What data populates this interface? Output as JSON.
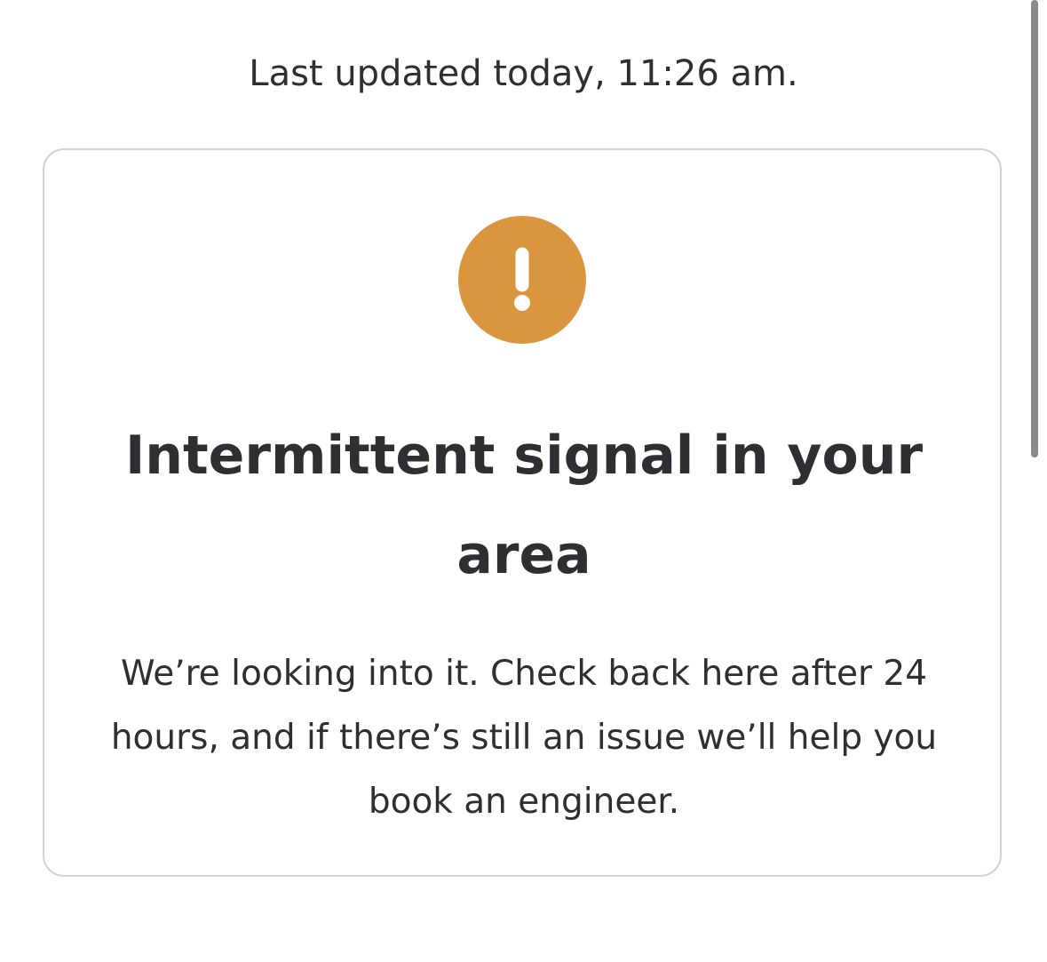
{
  "status": {
    "last_updated": "Last updated today, 11:26 am."
  },
  "alert": {
    "icon": "exclamation-icon",
    "icon_color": "#D9963E",
    "title": "Intermittent signal in your area",
    "message": "We’re looking into it. Check back here after 24 hours, and if there’s still an issue we’ll help you book an engineer."
  },
  "colors": {
    "text": "#2F2F33",
    "card_border": "#D3D3D3",
    "warning": "#D9963E"
  }
}
